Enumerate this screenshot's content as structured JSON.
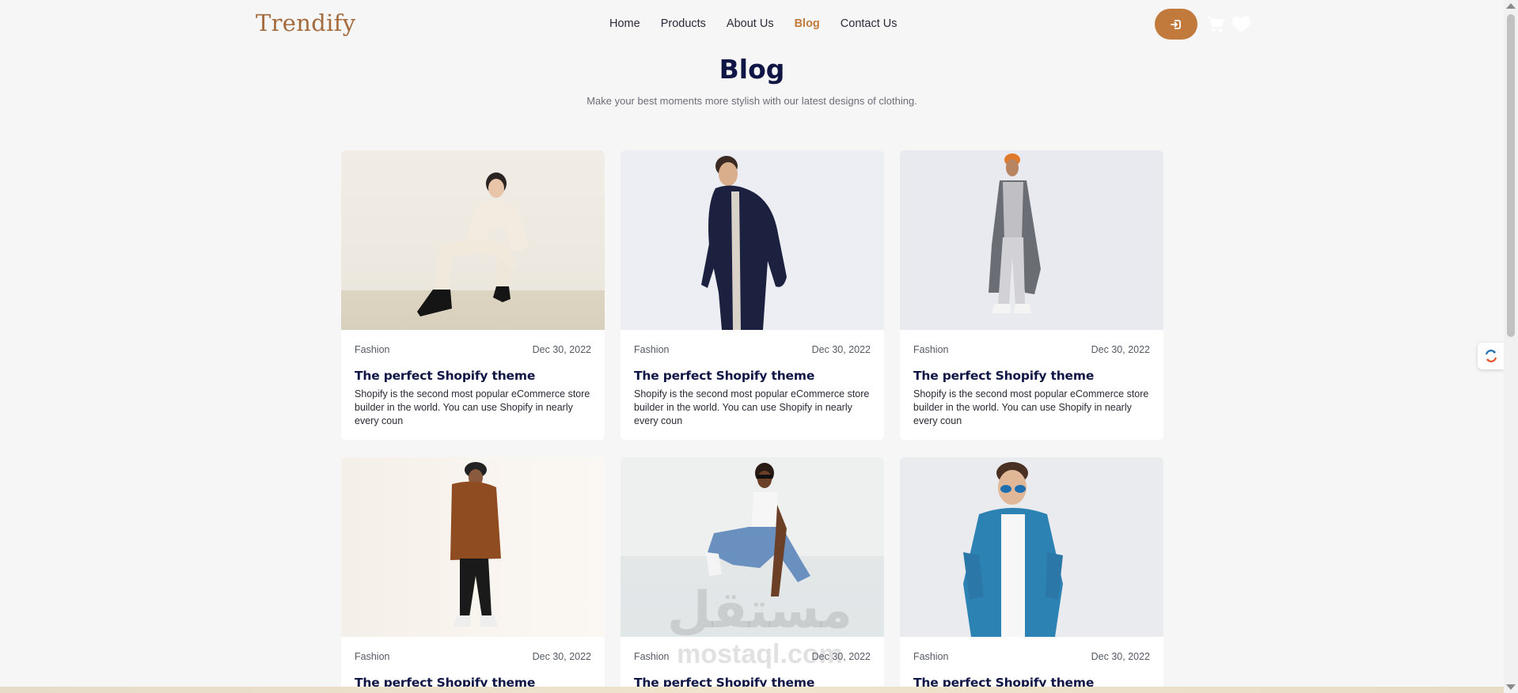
{
  "brand": {
    "logo_text": "Trendify",
    "accent": "#c27a3c",
    "title_color": "#0f1544"
  },
  "nav": {
    "items": [
      {
        "label": "Home"
      },
      {
        "label": "Products"
      },
      {
        "label": "About Us"
      },
      {
        "label": "Blog",
        "active": true
      },
      {
        "label": "Contact Us"
      }
    ]
  },
  "header_icons": [
    "login-icon",
    "cart-icon",
    "heart-icon"
  ],
  "page": {
    "title": "Blog",
    "subtitle": "Make your best moments more stylish with our latest designs of clothing."
  },
  "posts": [
    {
      "category": "Fashion",
      "date": "Dec 30, 2022",
      "title": "The perfect Shopify theme",
      "excerpt": "Shopify is the second most popular eCommerce store builder in the world. You can use Shopify in nearly every coun"
    },
    {
      "category": "Fashion",
      "date": "Dec 30, 2022",
      "title": "The perfect Shopify theme",
      "excerpt": "Shopify is the second most popular eCommerce store builder in the world. You can use Shopify in nearly every coun"
    },
    {
      "category": "Fashion",
      "date": "Dec 30, 2022",
      "title": "The perfect Shopify theme",
      "excerpt": "Shopify is the second most popular eCommerce store builder in the world. You can use Shopify in nearly every coun"
    },
    {
      "category": "Fashion",
      "date": "Dec 30, 2022",
      "title": "The perfect Shopify theme"
    },
    {
      "category": "Fashion",
      "date": "Dec 30, 2022",
      "title": "The perfect Shopify theme"
    },
    {
      "category": "Fashion",
      "date": "Dec 30, 2022",
      "title": "The perfect Shopify theme"
    }
  ],
  "watermark": {
    "arabic": "مستقل",
    "latin": "mostaql.com"
  }
}
